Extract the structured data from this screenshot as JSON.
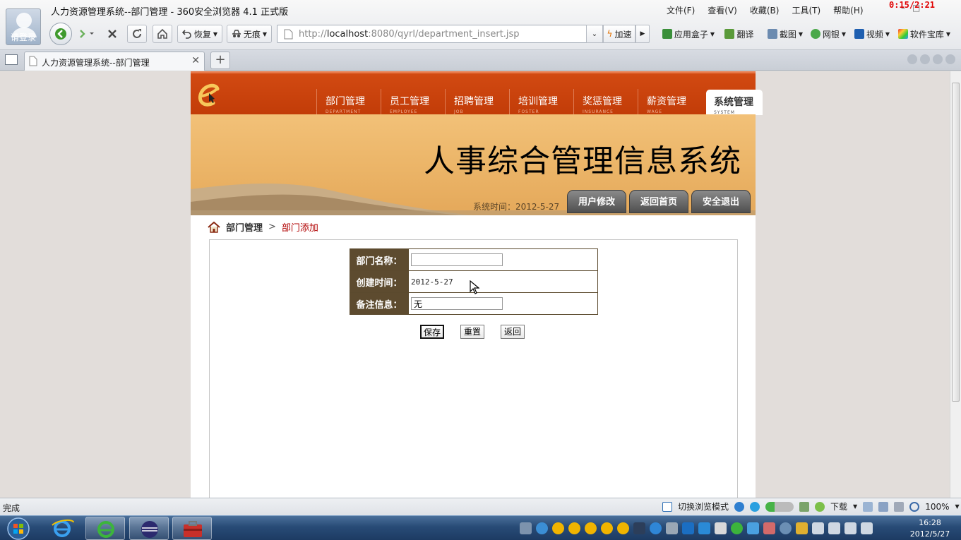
{
  "browser": {
    "window_title": "人力资源管理系统--部门管理 - 360安全浏览器 4.1 正式版",
    "login_label": "请登录",
    "menu": [
      "文件(F)",
      "查看(V)",
      "收藏(B)",
      "工具(T)",
      "帮助(H)"
    ],
    "timer": "0:15/2:21",
    "toolbar": {
      "restore": "恢复",
      "no_trace": "无痕",
      "speed_up": "加速"
    },
    "address": {
      "scheme": "http://",
      "host": "localhost",
      "port": ":8080",
      "path": "/qyrl/department_insert.jsp"
    },
    "extras": [
      "应用盒子",
      "翻译",
      "截图",
      "网银",
      "视频",
      "软件宝库"
    ],
    "tab_title": "人力资源管理系统--部门管理"
  },
  "app": {
    "nav": [
      {
        "label": "部门管理",
        "sub": "DEPARTMENT"
      },
      {
        "label": "员工管理",
        "sub": "EMPLOYEE"
      },
      {
        "label": "招聘管理",
        "sub": "JOB"
      },
      {
        "label": "培训管理",
        "sub": "FOSTER"
      },
      {
        "label": "奖惩管理",
        "sub": "INSURANCE"
      },
      {
        "label": "薪资管理",
        "sub": "WAGE"
      },
      {
        "label": "系统管理",
        "sub": "SYSTEM"
      }
    ],
    "banner_title": "人事综合管理信息系统",
    "system_time": "系统时间：2012-5-27",
    "tab_buttons": {
      "user_modify": "用户修改",
      "home": "返回首页",
      "logout": "安全退出"
    },
    "breadcrumb": {
      "parent": "部门管理",
      "separator": ">",
      "current": "部门添加"
    },
    "form": {
      "name_label": "部门名称：",
      "name_value": "",
      "created_label": "创建时间：",
      "created_value": "2012-5-27",
      "remark_label": "备注信息：",
      "remark_value": "无",
      "save": "保存",
      "reset": "重置",
      "back": "返回"
    }
  },
  "status": {
    "text": "完成",
    "mode": "切换浏览模式",
    "download": "下载",
    "zoom": "100%"
  },
  "taskbar": {
    "time": "16:28",
    "date": "2012/5/27"
  },
  "colors": {
    "nav_band": "#c7420c",
    "banner": "#ebb467",
    "label_cell": "#5d4b2f",
    "crumb_current": "#b00000"
  }
}
